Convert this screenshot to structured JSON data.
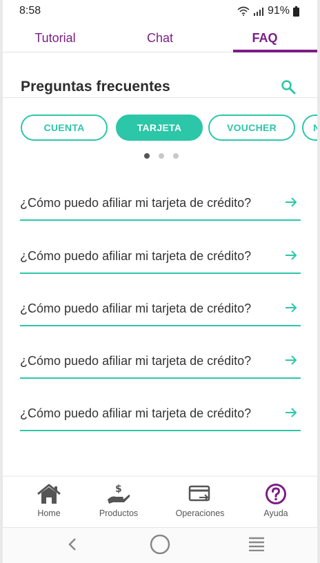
{
  "status_bar": {
    "time": "8:58",
    "battery": "91%"
  },
  "tabs": [
    {
      "label": "Tutorial",
      "active": false
    },
    {
      "label": "Chat",
      "active": false
    },
    {
      "label": "FAQ",
      "active": true
    }
  ],
  "header": {
    "title": "Preguntas frecuentes",
    "search_icon": "search-icon"
  },
  "chips": [
    {
      "label": "CUENTA",
      "active": false
    },
    {
      "label": "TARJETA",
      "active": true
    },
    {
      "label": "VOUCHER",
      "active": false
    },
    {
      "label": "N",
      "active": false
    }
  ],
  "pagination": {
    "current": 1,
    "total": 3
  },
  "faq": [
    {
      "question": "¿Cómo puedo afiliar mi tarjeta de crédito?"
    },
    {
      "question": "¿Cómo puedo afiliar mi tarjeta de crédito?"
    },
    {
      "question": "¿Cómo puedo afiliar mi tarjeta de crédito?"
    },
    {
      "question": "¿Cómo puedo afiliar mi tarjeta de crédito?"
    },
    {
      "question": "¿Cómo puedo afiliar mi tarjeta de crédito?"
    }
  ],
  "bottom_nav": [
    {
      "label": "Home",
      "icon": "home-icon",
      "active": false
    },
    {
      "label": "Productos",
      "icon": "products-icon",
      "active": false
    },
    {
      "label": "Operaciones",
      "icon": "operations-icon",
      "active": false
    },
    {
      "label": "Ayuda",
      "icon": "help-icon",
      "active": true
    }
  ],
  "colors": {
    "brand_purple": "#7b1e86",
    "accent_teal": "#2cc6a8",
    "text": "#333333"
  }
}
